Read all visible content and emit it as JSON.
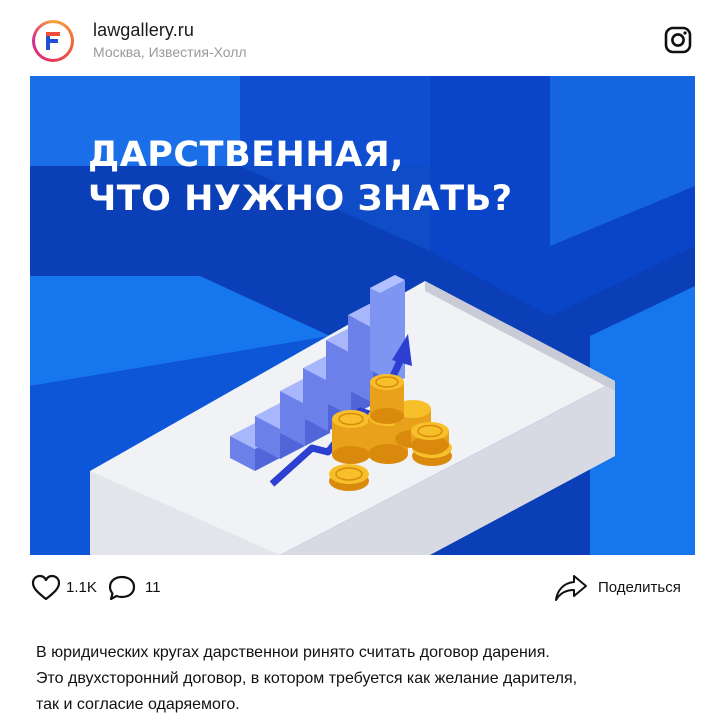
{
  "header": {
    "account_name": "lawgallery.ru",
    "location": "Москва, Известия-Холл",
    "avatar_logo": "F-logo-icon",
    "platform_icon": "instagram-icon"
  },
  "post": {
    "headline_line1": "ДАРСТВЕННАЯ,",
    "headline_line2": "ЧТО НУЖНО ЗНАТЬ?",
    "illustration": "isometric bar chart with rising arrow and gold coins",
    "colors": {
      "background_blue": "#0b3fb8",
      "accent_blue": "#1a6fe8",
      "coin_gold": "#f2b01e",
      "bar_blue": "#7e95f2"
    }
  },
  "actions": {
    "likes": "1.1K",
    "comments": "11",
    "share_label": "Поделиться"
  },
  "caption": {
    "line1": "В юридических кругах дарственнои ринято считать договор дарения.",
    "line2": "Это двухсторонний договор, в котором требуется как желание дарителя,",
    "line3": "так и согласие одаряемого."
  }
}
